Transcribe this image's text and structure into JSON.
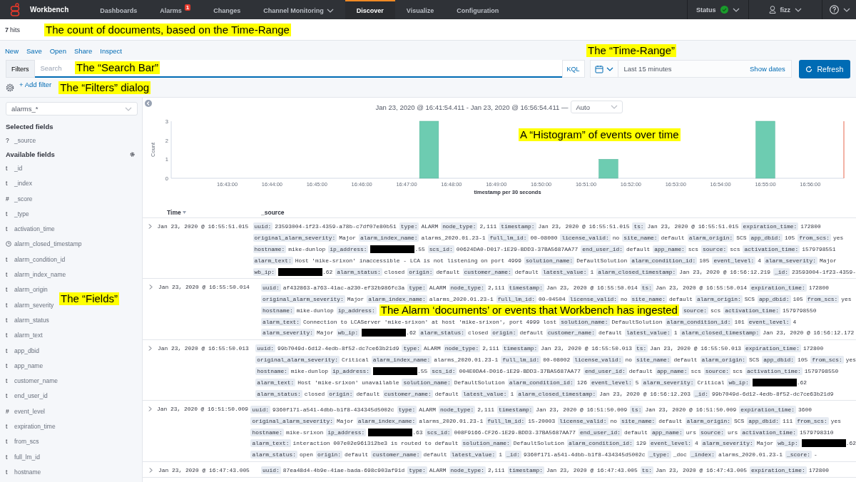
{
  "topbar": {
    "brand": "Workbench",
    "nav": [
      {
        "label": "Dashboards",
        "selected": false,
        "has_menu": false
      },
      {
        "label": "Alarms",
        "selected": false,
        "has_menu": false,
        "badge": "1"
      },
      {
        "label": "Changes",
        "selected": false,
        "has_menu": false
      },
      {
        "label": "Channel Monitoring",
        "selected": false,
        "has_menu": true
      },
      {
        "label": "Discover",
        "selected": true,
        "has_menu": false
      },
      {
        "label": "Visualize",
        "selected": false,
        "has_menu": false
      },
      {
        "label": "Configuration",
        "selected": false,
        "has_menu": false
      }
    ],
    "status": {
      "label": "Status",
      "ok": true
    },
    "user": "fizz"
  },
  "hits": {
    "count": "7",
    "label": "hits",
    "annotation": "The count of documents, based on the Time-Range"
  },
  "menu": [
    "New",
    "Save",
    "Open",
    "Share",
    "Inspect"
  ],
  "menu_annotation": "The “Time-Range”",
  "query": {
    "filters_label": "Filters",
    "placeholder": "Search",
    "annotation": "The “Search Bar”",
    "language": "KQL"
  },
  "time_range": {
    "text": "Last 15 minutes",
    "show_dates": "Show dates"
  },
  "refresh": "Refresh",
  "filters": {
    "add": "+ Add filter",
    "annotation": "The “Filters” dialog"
  },
  "sidebar": {
    "index_pattern": "alarms_*",
    "selected_title": "Selected fields",
    "selected_fields": [
      {
        "kind": "text",
        "glyph": "?",
        "name": "_source"
      }
    ],
    "available_title": "Available fields",
    "annotation": "The “Fields”",
    "available_fields": [
      {
        "kind": "text",
        "glyph": "t",
        "name": "_id"
      },
      {
        "kind": "text",
        "glyph": "t",
        "name": "_index"
      },
      {
        "kind": "text",
        "glyph": "#",
        "name": "_score"
      },
      {
        "kind": "text",
        "glyph": "t",
        "name": "_type"
      },
      {
        "kind": "text",
        "glyph": "t",
        "name": "activation_time"
      },
      {
        "kind": "date",
        "name": "alarm_closed_timestamp"
      },
      {
        "kind": "text",
        "glyph": "t",
        "name": "alarm_condition_id"
      },
      {
        "kind": "text",
        "glyph": "t",
        "name": "alarm_index_name"
      },
      {
        "kind": "text",
        "glyph": "t",
        "name": "alarm_origin"
      },
      {
        "kind": "text",
        "glyph": "t",
        "name": "alarm_severity"
      },
      {
        "kind": "text",
        "glyph": "t",
        "name": "alarm_status"
      },
      {
        "kind": "text",
        "glyph": "t",
        "name": "alarm_text"
      },
      {
        "kind": "text",
        "glyph": "t",
        "name": "app_dbid"
      },
      {
        "kind": "text",
        "glyph": "t",
        "name": "app_name"
      },
      {
        "kind": "text",
        "glyph": "t",
        "name": "customer_name"
      },
      {
        "kind": "text",
        "glyph": "t",
        "name": "end_user_id"
      },
      {
        "kind": "text",
        "glyph": "#",
        "name": "event_level"
      },
      {
        "kind": "text",
        "glyph": "t",
        "name": "expiration_time"
      },
      {
        "kind": "text",
        "glyph": "t",
        "name": "from_scs"
      },
      {
        "kind": "text",
        "glyph": "t",
        "name": "full_lm_id"
      },
      {
        "kind": "text",
        "glyph": "t",
        "name": "hostname"
      }
    ]
  },
  "histogram": {
    "range": "Jan 23, 2020 @ 16:41:54.411 - Jan 23, 2020 @ 16:56:54.411 —",
    "interval": "Auto",
    "annotation": "A “Histogram” of events over time",
    "chart_data": {
      "type": "bar",
      "xlabel": "timestamp per 30 seconds",
      "ylabel": "Count",
      "categories": [
        null,
        null,
        "16:43:00",
        null,
        "16:44:00",
        null,
        "16:45:00",
        null,
        "16:46:00",
        null,
        "16:47:00",
        null,
        "16:48:00",
        null,
        "16:49:00",
        null,
        "16:50:00",
        null,
        "16:51:00",
        null,
        "16:52:00",
        null,
        "16:53:00",
        null,
        "16:54:00",
        null,
        "16:55:00",
        null,
        "16:56:00",
        null
      ],
      "values": [
        0,
        0,
        0,
        0,
        0,
        0,
        0,
        0,
        0,
        0,
        0,
        3,
        0,
        0,
        0,
        0,
        0,
        0,
        0,
        1,
        0,
        0,
        0,
        0,
        0,
        0,
        3,
        0,
        0,
        0
      ],
      "ylim": [
        0,
        3
      ],
      "yticks": [
        0,
        1,
        2,
        3
      ]
    }
  },
  "table": {
    "columns": [
      "Time",
      "_source"
    ],
    "rows": [
      {
        "time": "Jan 23, 2020 @ 16:55:51.015",
        "lines": [
          [
            {
              "k": "uuid:",
              "v": "23593004-1f23-4359-a78b-c7df07e80b51",
              "redacted": false
            },
            {
              "k": "type:",
              "v": "ALARM",
              "redacted": false
            },
            {
              "k": "node_type:",
              "v": "2,111",
              "redacted": false
            },
            {
              "k": "timestamp:",
              "v": "Jan 23, 2020 @ 16:55:51.015",
              "redacted": false
            },
            {
              "k": "ts:",
              "v": "Jan 23, 2020 @ 16:55:51.015",
              "redacted": false
            },
            {
              "k": "expiration_time:",
              "v": "172800",
              "redacted": false
            }
          ],
          [
            {
              "k": "original_alarm_severity:",
              "v": "Major",
              "redacted": false
            },
            {
              "k": "alarm_index_name:",
              "v": "alarms_2020.01.23-1",
              "redacted": false
            },
            {
              "k": "full_lm_id:",
              "v": "00-08000",
              "redacted": false
            },
            {
              "k": "license_valid:",
              "v": "no",
              "redacted": false
            },
            {
              "k": "site_name:",
              "v": "default",
              "redacted": false
            },
            {
              "k": "alarm_origin:",
              "v": "SCS",
              "redacted": false
            },
            {
              "k": "app_dbid:",
              "v": "105",
              "redacted": false
            },
            {
              "k": "from_scs:",
              "v": "yes",
              "redacted": false
            }
          ],
          [
            {
              "k": "hostname:",
              "v": "mike-dunlop",
              "redacted": false
            },
            {
              "k": "ip_address:",
              "v": ".55",
              "redacted": true
            },
            {
              "k": "scs_id:",
              "v": "00624DA0-D017-1E29-BDD3-37BA5687AA77",
              "redacted": false
            },
            {
              "k": "end_user_id:",
              "v": "default",
              "redacted": false
            },
            {
              "k": "app_name:",
              "v": "scs",
              "redacted": false
            },
            {
              "k": "source:",
              "v": "scs",
              "redacted": false
            },
            {
              "k": "activation_time:",
              "v": "1579798551",
              "redacted": false
            }
          ],
          [
            {
              "k": "alarm_text:",
              "v": "Host 'mike-srixon' inaccessible - LCA is not listening on port 4999",
              "redacted": false
            },
            {
              "k": "solution_name:",
              "v": "DefaultSolution",
              "redacted": false
            },
            {
              "k": "alarm_condition_id:",
              "v": "105",
              "redacted": false
            },
            {
              "k": "event_level:",
              "v": "4",
              "redacted": false
            },
            {
              "k": "alarm_severity:",
              "v": "Major",
              "redacted": false
            }
          ],
          [
            {
              "k": "wb_ip:",
              "v": ".62",
              "redacted": true
            },
            {
              "k": "alarm_status:",
              "v": "closed",
              "redacted": false
            },
            {
              "k": "origin:",
              "v": "default",
              "redacted": false
            },
            {
              "k": "customer_name:",
              "v": "default",
              "redacted": false
            },
            {
              "k": "latest_value:",
              "v": "1",
              "redacted": false
            },
            {
              "k": "alarm_closed_timestamp:",
              "v": "Jan 23, 2020 @ 16:56:12.219",
              "redacted": false
            },
            {
              "k": "_id:",
              "v": "23593004-1f23-4359-",
              "redacted": false
            }
          ]
        ]
      },
      {
        "time": "Jan 23, 2020 @ 16:55:50.014",
        "lines": [
          [
            {
              "k": "uuid:",
              "v": "af432863-a763-41ac-a230-ef32b986fc3a",
              "redacted": false
            },
            {
              "k": "type:",
              "v": "ALARM",
              "redacted": false
            },
            {
              "k": "node_type:",
              "v": "2,111",
              "redacted": false
            },
            {
              "k": "timestamp:",
              "v": "Jan 23, 2020 @ 16:55:50.014",
              "redacted": false
            },
            {
              "k": "ts:",
              "v": "Jan 23, 2020 @ 16:55:50.014",
              "redacted": false
            },
            {
              "k": "expiration_time:",
              "v": "172800",
              "redacted": false
            }
          ],
          [
            {
              "k": "original_alarm_severity:",
              "v": "Major",
              "redacted": false
            },
            {
              "k": "alarm_index_name:",
              "v": "alarms_2020.01.23-1",
              "redacted": false
            },
            {
              "k": "full_lm_id:",
              "v": "00-04504",
              "redacted": false
            },
            {
              "k": "license_valid:",
              "v": "no",
              "redacted": false
            },
            {
              "k": "site_name:",
              "v": "default",
              "redacted": false
            },
            {
              "k": "alarm_origin:",
              "v": "SCS",
              "redacted": false
            },
            {
              "k": "app_dbid:",
              "v": "105",
              "redacted": false
            },
            {
              "k": "from_scs:",
              "v": "yes",
              "redacted": false
            }
          ],
          [
            {
              "k": "hostname:",
              "v": "mike-dunlop",
              "redacted": false
            },
            {
              "k": "ip_address:",
              "redacted": false
            },
            {
              "note": "The Alarm ‘documents’ or events that Workbench has ingested"
            },
            {
              "k": "source:",
              "v": "scs",
              "redacted": false
            },
            {
              "k": "activation_time:",
              "v": "1579798550",
              "redacted": false
            }
          ],
          [
            {
              "k": "alarm_text:",
              "v": "Connection to LCAServer 'mike-srixon' at host 'mike-srixon', port 4999 lost",
              "redacted": false
            },
            {
              "k": "solution_name:",
              "v": "DefaultSolution",
              "redacted": false
            },
            {
              "k": "alarm_condition_id:",
              "v": "101",
              "redacted": false
            },
            {
              "k": "event_level:",
              "v": "4",
              "redacted": false
            }
          ],
          [
            {
              "k": "alarm_severity:",
              "v": "Major",
              "redacted": false
            },
            {
              "k": "wb_ip:",
              "v": ".62",
              "redacted": true
            },
            {
              "k": "alarm_status:",
              "v": "closed",
              "redacted": false
            },
            {
              "k": "origin:",
              "v": "default",
              "redacted": false
            },
            {
              "k": "customer_name:",
              "v": "default",
              "redacted": false
            },
            {
              "k": "latest_value:",
              "v": "1",
              "redacted": false
            },
            {
              "k": "alarm_closed_timestamp:",
              "v": "Jan 23, 2020 @ 16:56:12.172",
              "redacted": false
            }
          ]
        ]
      },
      {
        "time": "Jan 23, 2020 @ 16:55:50.013",
        "lines": [
          [
            {
              "k": "uuid:",
              "v": "99b7049d-6d12-4edb-8f52-dc7ce63b21d9",
              "redacted": false
            },
            {
              "k": "type:",
              "v": "ALARM",
              "redacted": false
            },
            {
              "k": "node_type:",
              "v": "2,111",
              "redacted": false
            },
            {
              "k": "timestamp:",
              "v": "Jan 23, 2020 @ 16:55:50.013",
              "redacted": false
            },
            {
              "k": "ts:",
              "v": "Jan 23, 2020 @ 16:55:50.013",
              "redacted": false
            },
            {
              "k": "expiration_time:",
              "v": "172800",
              "redacted": false
            }
          ],
          [
            {
              "k": "original_alarm_severity:",
              "v": "Critical",
              "redacted": false
            },
            {
              "k": "alarm_index_name:",
              "v": "alarms_2020.01.23-1",
              "redacted": false
            },
            {
              "k": "full_lm_id:",
              "v": "00-08002",
              "redacted": false
            },
            {
              "k": "license_valid:",
              "v": "no",
              "redacted": false
            },
            {
              "k": "site_name:",
              "v": "default",
              "redacted": false
            },
            {
              "k": "alarm_origin:",
              "v": "SCS",
              "redacted": false
            },
            {
              "k": "app_dbid:",
              "v": "105",
              "redacted": false
            },
            {
              "k": "from_scs:",
              "v": "yes",
              "redacted": false
            }
          ],
          [
            {
              "k": "hostname:",
              "v": "mike-dunlop",
              "redacted": false
            },
            {
              "k": "ip_address:",
              "v": ".55",
              "redacted": true
            },
            {
              "k": "scs_id:",
              "v": "004E0DA4-D016-1E29-BDD3-37BA5687AA77",
              "redacted": false
            },
            {
              "k": "end_user_id:",
              "v": "default",
              "redacted": false
            },
            {
              "k": "app_name:",
              "v": "scs",
              "redacted": false
            },
            {
              "k": "source:",
              "v": "scs",
              "redacted": false
            },
            {
              "k": "activation_time:",
              "v": "1579798550",
              "redacted": false
            }
          ],
          [
            {
              "k": "alarm_text:",
              "v": "Host 'mike-srixon' unavailable",
              "redacted": false
            },
            {
              "k": "solution_name:",
              "v": "DefaultSolution",
              "redacted": false
            },
            {
              "k": "alarm_condition_id:",
              "v": "126",
              "redacted": false
            },
            {
              "k": "event_level:",
              "v": "5",
              "redacted": false
            },
            {
              "k": "alarm_severity:",
              "v": "Critical",
              "redacted": false
            },
            {
              "k": "wb_ip:",
              "v": ".62",
              "redacted": true
            }
          ],
          [
            {
              "k": "alarm_status:",
              "v": "closed",
              "redacted": false
            },
            {
              "k": "origin:",
              "v": "default",
              "redacted": false
            },
            {
              "k": "customer_name:",
              "v": "default",
              "redacted": false
            },
            {
              "k": "latest_value:",
              "v": "1",
              "redacted": false
            },
            {
              "k": "alarm_closed_timestamp:",
              "v": "Jan 23, 2020 @ 16:56:12.203",
              "redacted": false
            },
            {
              "k": "_id:",
              "v": "99b7049d-6d12-4edb-8f52-dc7ce63b21d9",
              "redacted": false
            }
          ]
        ]
      },
      {
        "time": "Jan 23, 2020 @ 16:51:50.009",
        "lines": [
          [
            {
              "k": "uuid:",
              "v": "9360f171-a541-4dbb-b1f8-434345d5002c",
              "redacted": false
            },
            {
              "k": "type:",
              "v": "ALARM",
              "redacted": false
            },
            {
              "k": "node_type:",
              "v": "2,111",
              "redacted": false
            },
            {
              "k": "timestamp:",
              "v": "Jan 23, 2020 @ 16:51:50.009",
              "redacted": false
            },
            {
              "k": "ts:",
              "v": "Jan 23, 2020 @ 16:51:50.009",
              "redacted": false
            },
            {
              "k": "expiration_time:",
              "v": "3600",
              "redacted": false
            }
          ],
          [
            {
              "k": "original_alarm_severity:",
              "v": "Major",
              "redacted": false
            },
            {
              "k": "alarm_index_name:",
              "v": "alarms_2020.01.23-1",
              "redacted": false
            },
            {
              "k": "full_lm_id:",
              "v": "15-20003",
              "redacted": false
            },
            {
              "k": "license_valid:",
              "v": "no",
              "redacted": false
            },
            {
              "k": "site_name:",
              "v": "default",
              "redacted": false
            },
            {
              "k": "alarm_origin:",
              "v": "SCS",
              "redacted": false
            },
            {
              "k": "app_dbid:",
              "v": "111",
              "redacted": false
            },
            {
              "k": "from_scs:",
              "v": "yes",
              "redacted": false
            }
          ],
          [
            {
              "k": "hostname:",
              "v": "mike-srixon",
              "redacted": false
            },
            {
              "k": "ip_address:",
              "v": ".63",
              "redacted": true
            },
            {
              "k": "scs_id:",
              "v": "008F9166-CF26-1E29-BDD3-37BA5687AA77",
              "redacted": false
            },
            {
              "k": "end_user_id:",
              "v": "default",
              "redacted": false
            },
            {
              "k": "app_name:",
              "v": "urs",
              "redacted": false
            },
            {
              "k": "source:",
              "v": "urs",
              "redacted": false
            },
            {
              "k": "activation_time:",
              "v": "1579798310",
              "redacted": false
            }
          ],
          [
            {
              "k": "alarm_text:",
              "v": "interaction 007e02e961312be3 is routed to default",
              "redacted": false
            },
            {
              "k": "solution_name:",
              "v": "DefaultSolution",
              "redacted": false
            },
            {
              "k": "alarm_condition_id:",
              "v": "129",
              "redacted": false
            },
            {
              "k": "event_level:",
              "v": "4",
              "redacted": false
            },
            {
              "k": "alarm_severity:",
              "v": "Major",
              "redacted": false
            },
            {
              "k": "wb_ip:",
              "v": ".62",
              "redacted": true
            }
          ],
          [
            {
              "k": "alarm_status:",
              "v": "open",
              "redacted": false
            },
            {
              "k": "origin:",
              "v": "default",
              "redacted": false
            },
            {
              "k": "customer_name:",
              "v": "default",
              "redacted": false
            },
            {
              "k": "latest_value:",
              "v": "1",
              "redacted": false
            },
            {
              "k": "_id:",
              "v": "9360f171-a541-4dbb-b1f8-434345d5002c",
              "redacted": false
            },
            {
              "k": "_type:",
              "v": "_doc",
              "redacted": false
            },
            {
              "k": "_index:",
              "v": "alarms_2020.01.23-1",
              "redacted": false
            },
            {
              "k": "_score:",
              "v": "-",
              "redacted": false
            }
          ]
        ]
      },
      {
        "time": "Jan 23, 2020 @ 16:47:43.005",
        "lines": [
          [
            {
              "k": "uuid:",
              "v": "87ea48d4-4b9e-41ae-bada-698c903af91d",
              "redacted": false
            },
            {
              "k": "type:",
              "v": "ALARM",
              "redacted": false
            },
            {
              "k": "node_type:",
              "v": "2,111",
              "redacted": false
            },
            {
              "k": "timestamp:",
              "v": "Jan 23, 2020 @ 16:47:43.005",
              "redacted": false
            },
            {
              "k": "ts:",
              "v": "Jan 23, 2020 @ 16:47:43.005",
              "redacted": false
            },
            {
              "k": "expiration_time:",
              "v": "172800",
              "redacted": false
            }
          ]
        ]
      }
    ]
  }
}
